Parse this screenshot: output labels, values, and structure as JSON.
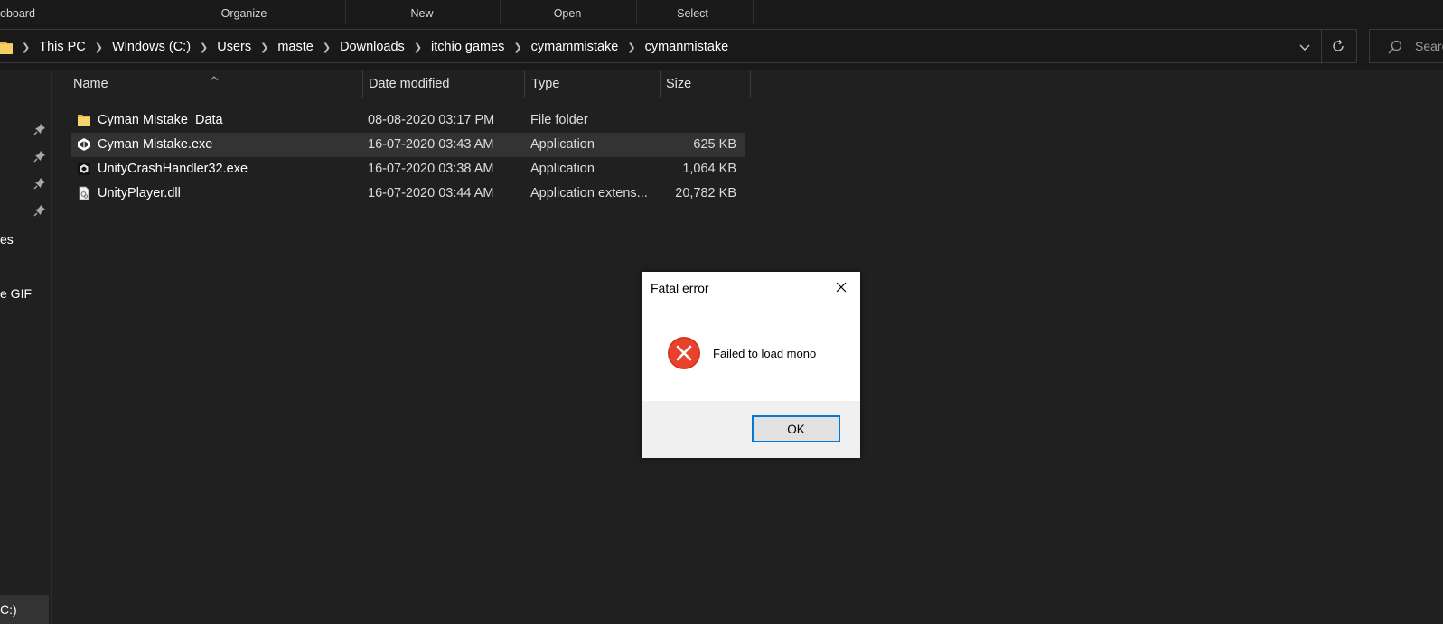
{
  "ribbon": {
    "groups": [
      "oboard",
      "Organize",
      "New",
      "Open",
      "Select"
    ]
  },
  "address": {
    "crumbs": [
      "This PC",
      "Windows (C:)",
      "Users",
      "maste",
      "Downloads",
      "itchio games",
      "cymammistake",
      "cymanmistake"
    ],
    "search_placeholder": "Searc"
  },
  "nav": {
    "items": [
      "es",
      "e GIF",
      "C:)"
    ]
  },
  "columns": {
    "name": "Name",
    "date": "Date modified",
    "type": "Type",
    "size": "Size"
  },
  "files": [
    {
      "name": "Cyman Mistake_Data",
      "date": "08-08-2020 03:17 PM",
      "type": "File folder",
      "size": "",
      "icon": "folder-icon"
    },
    {
      "name": "Cyman Mistake.exe",
      "date": "16-07-2020 03:43 AM",
      "type": "Application",
      "size": "625 KB",
      "icon": "unity-app-icon"
    },
    {
      "name": "UnityCrashHandler32.exe",
      "date": "16-07-2020 03:38 AM",
      "type": "Application",
      "size": "1,064 KB",
      "icon": "unity-app-icon"
    },
    {
      "name": "UnityPlayer.dll",
      "date": "16-07-2020 03:44 AM",
      "type": "Application extens...",
      "size": "20,782 KB",
      "icon": "dll-file-icon"
    }
  ],
  "dialog": {
    "title": "Fatal error",
    "message": "Failed to load mono",
    "ok_label": "OK"
  },
  "colors": {
    "background": "#202020",
    "selection": "#333333",
    "error_red": "#e8412c",
    "dialog_accent": "#0078d7"
  }
}
